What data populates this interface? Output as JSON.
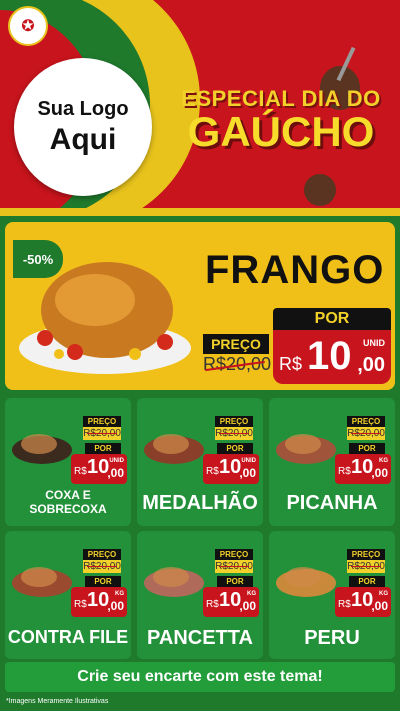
{
  "brand": {
    "logo_line1": "Sua Logo",
    "logo_line2": "Aqui",
    "title_top": "ESPECIAL DIA DO",
    "title_main": "GAÚCHO"
  },
  "featured": {
    "discount": "-50%",
    "name": "FRANGO",
    "preco_label": "PREÇO",
    "old_price": "R$20,00",
    "por_label": "POR",
    "currency": "R$",
    "price_int": "10",
    "price_cents": ",00",
    "unit": "UNID"
  },
  "products": [
    {
      "name": "COXA E SOBRECOXA",
      "preco_label": "PREÇO",
      "old_price": "R$20,00",
      "por_label": "POR",
      "currency": "R$",
      "price_int": "10",
      "price_cents": ",00",
      "unit": "UNID",
      "icon": "chicken-thigh-icon"
    },
    {
      "name": "MEDALHÃO",
      "preco_label": "PREÇO",
      "old_price": "R$20,00",
      "por_label": "POR",
      "currency": "R$",
      "price_int": "10",
      "price_cents": ",00",
      "unit": "UNID",
      "icon": "skewer-icon"
    },
    {
      "name": "PICANHA",
      "preco_label": "PREÇO",
      "old_price": "R$20,00",
      "por_label": "POR",
      "currency": "R$",
      "price_int": "10",
      "price_cents": ",00",
      "unit": "KG",
      "icon": "steak-icon"
    },
    {
      "name": "CONTRA FILE",
      "preco_label": "PREÇO",
      "old_price": "R$20,00",
      "por_label": "POR",
      "currency": "R$",
      "price_int": "10",
      "price_cents": ",00",
      "unit": "KG",
      "icon": "meat-icon"
    },
    {
      "name": "PANCETTA",
      "preco_label": "PREÇO",
      "old_price": "R$20,00",
      "por_label": "POR",
      "currency": "R$",
      "price_int": "10",
      "price_cents": ",00",
      "unit": "KG",
      "icon": "pork-icon"
    },
    {
      "name": "PERU",
      "preco_label": "PREÇO",
      "old_price": "R$20,00",
      "por_label": "POR",
      "currency": "R$",
      "price_int": "10",
      "price_cents": ",00",
      "unit": "KG",
      "icon": "turkey-icon"
    }
  ],
  "footer": {
    "cta": "Crie seu encarte com este tema!",
    "disclaimer": "*Imagens Meramente Ilustrativas"
  },
  "colors": {
    "red": "#c8141c",
    "green": "#1f7a2c",
    "yellow": "#f0c019",
    "black": "#111111"
  }
}
